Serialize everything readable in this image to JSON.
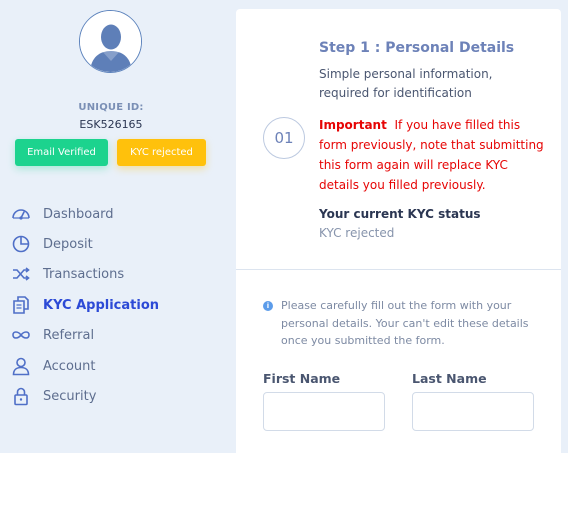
{
  "sidebar": {
    "unique_id_label": "UNIQUE ID:",
    "unique_id_value": "ESK526165",
    "badges": {
      "email": "Email Verified",
      "kyc": "KYC rejected"
    },
    "items": [
      {
        "label": "Dashboard",
        "icon": "dashboard-icon"
      },
      {
        "label": "Deposit",
        "icon": "pie-chart-icon"
      },
      {
        "label": "Transactions",
        "icon": "shuffle-icon"
      },
      {
        "label": "KYC Application",
        "icon": "documents-icon",
        "active": true
      },
      {
        "label": "Referral",
        "icon": "infinity-icon"
      },
      {
        "label": "Account",
        "icon": "user-icon"
      },
      {
        "label": "Security",
        "icon": "lock-icon"
      }
    ]
  },
  "step": {
    "number": "01",
    "title": "Step 1 : Personal Details",
    "subtitle": "Simple personal information, required for identification",
    "important_label": "Important",
    "important_text": "If you have filled this form previously, note that submitting this form again will replace KYC details you filled previously.",
    "status_label": "Your current KYC status",
    "status_value": "KYC rejected"
  },
  "form": {
    "note": "Please carefully fill out the form with your personal details. Your can't edit these details once you submitted the form.",
    "first_name_label": "First Name",
    "last_name_label": "Last Name",
    "first_name_value": "",
    "last_name_value": ""
  },
  "colors": {
    "accent": "#2c4ad6",
    "success": "#1cd38e",
    "warning": "#ffc10c",
    "danger": "#e60404",
    "sidebar_bg": "#e9f0f9"
  }
}
